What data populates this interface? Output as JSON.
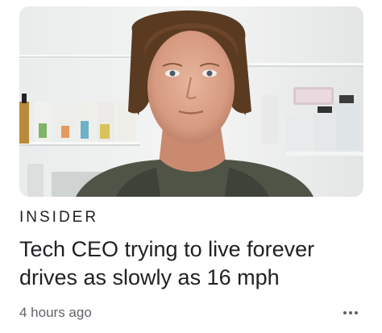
{
  "article": {
    "publisher": "INSIDER",
    "headline": "Tech CEO trying to live forever drives as slowly as 16 mph",
    "time_ago": "4 hours ago",
    "more_icon": "more-horizontal-icon",
    "thumbnail_icon": "article-thumbnail-photo"
  }
}
